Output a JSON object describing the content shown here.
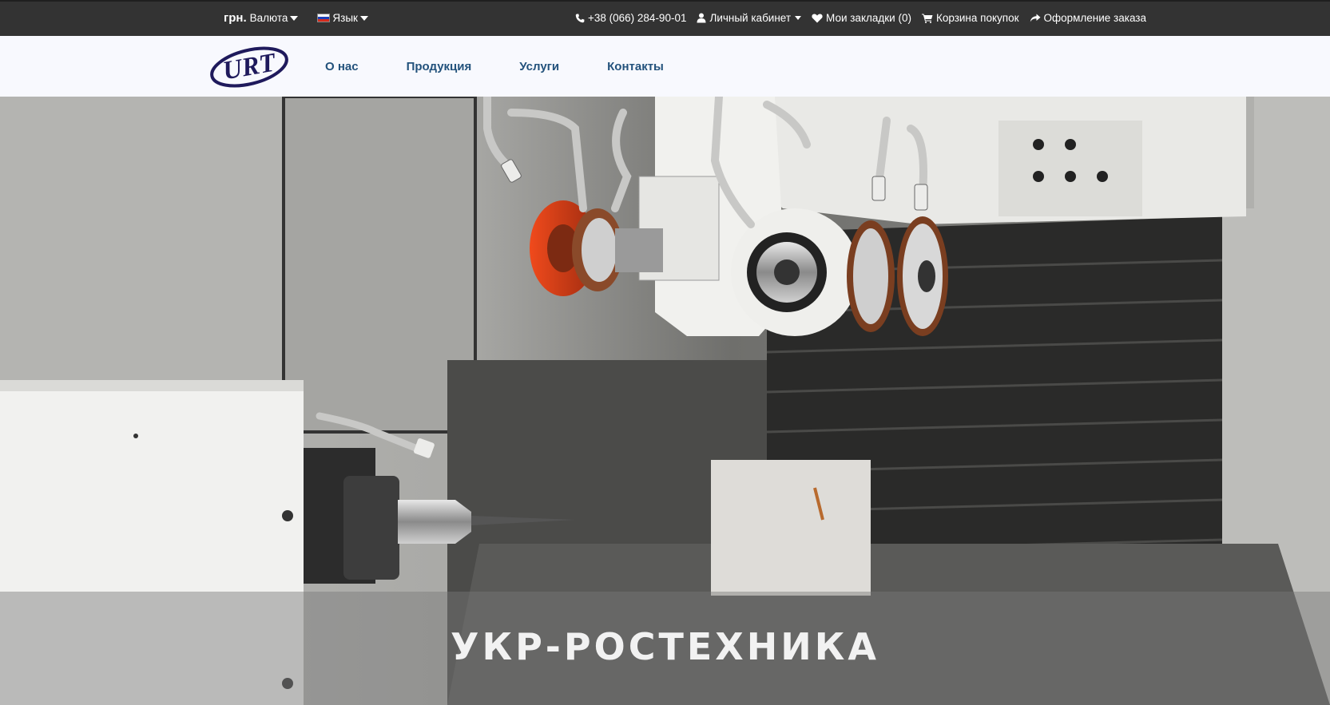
{
  "topbar": {
    "currency_symbol": "грн.",
    "currency_label": "Валюта",
    "language_label": "Язык",
    "phone": "+38 (066) 284-90-01",
    "account": "Личный кабинет",
    "wishlist": "Мои закладки (0)",
    "cart": "Корзина покупок",
    "checkout": "Оформление заказа"
  },
  "header": {
    "logo_text": "URT",
    "nav": [
      "О нас",
      "Продукция",
      "Услуги",
      "Контакты"
    ]
  },
  "hero": {
    "title": "УКР-РОСТЕХНИКА"
  },
  "colors": {
    "topbar_bg": "#333333",
    "nav_bg": "#f8f9fe",
    "nav_link": "#23527c",
    "logo": "#1f1a5c"
  }
}
